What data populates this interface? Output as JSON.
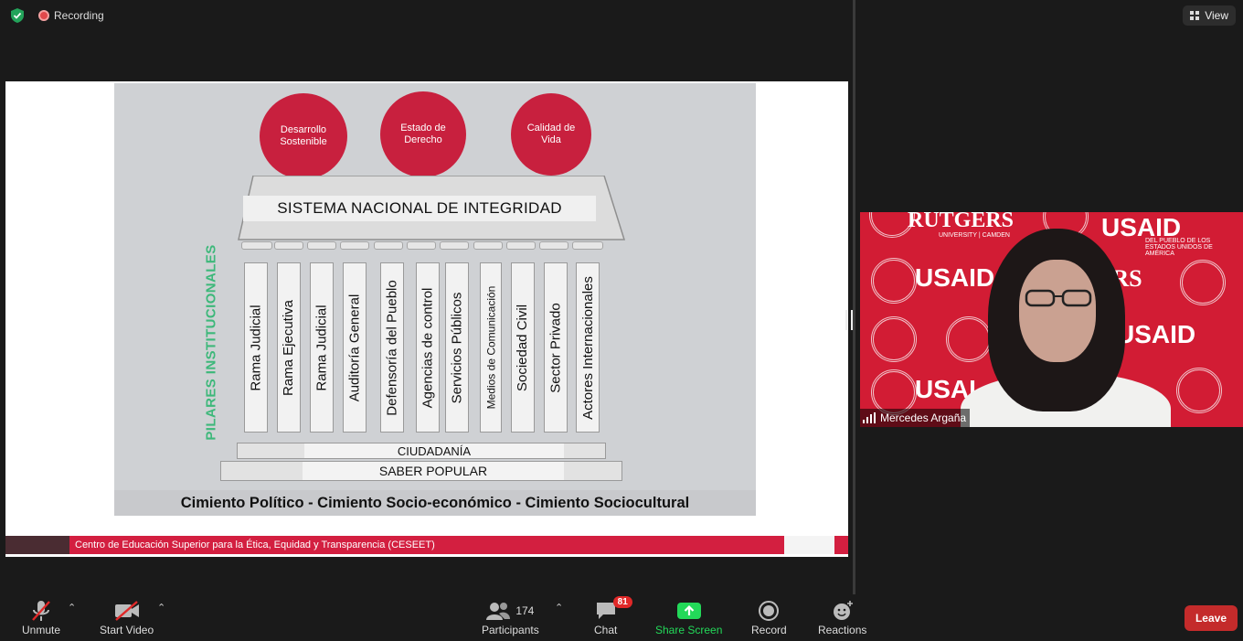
{
  "topbar": {
    "recording_label": "Recording",
    "view_label": "View"
  },
  "slide": {
    "circles": [
      "Desarrollo Sostenible",
      "Estado de Derecho",
      "Calidad de Vida"
    ],
    "banner": "SISTEMA NACIONAL DE INTEGRIDAD",
    "pillars_title": "PILARES INSTITUCIONALES",
    "pillars": [
      "Rama Judicial",
      "Rama Ejecutiva",
      "Rama Judicial",
      "Auditoría General",
      "Defensoría del Pueblo",
      "Agencias de control",
      "Servicios Públicos",
      "Medios de Comunicación",
      "Sociedad Civil",
      "Sector Privado",
      "Actores Internacionales"
    ],
    "base_top": "CIUDADANÍA",
    "base_bottom": "SABER POPULAR",
    "foundation": "Cimiento Político - Cimiento Socio-económico - Cimiento Sociocultural",
    "footer_org": "Centro de Educación Superior para la Ética, Equidad y Transparencia (CESEET)"
  },
  "video": {
    "participant_name": "Mercedes Argaña",
    "background_logos": [
      "RUTGERS",
      "USAID",
      "USAID",
      "USAID",
      "USAI",
      "ERS"
    ],
    "background_sublabels": [
      "UNIVERSITY | CAMDEN",
      "DEL PUEBLO DE LOS ESTADOS UNIDOS DE AMÉRICA"
    ]
  },
  "toolbar": {
    "unmute": "Unmute",
    "start_video": "Start Video",
    "participants_count": "174",
    "participants": "Participants",
    "chat": "Chat",
    "chat_badge": "81",
    "share_screen": "Share Screen",
    "record": "Record",
    "reactions": "Reactions",
    "leave": "Leave"
  },
  "colors": {
    "accent_green": "#23d959",
    "slide_red": "#c8203e",
    "leave_red": "#c42b2b"
  }
}
